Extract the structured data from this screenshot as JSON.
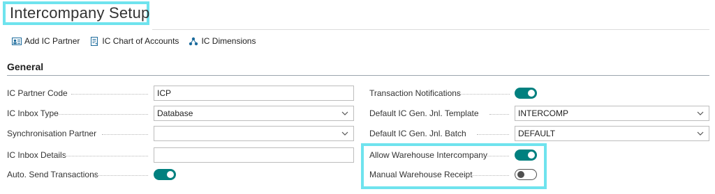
{
  "page": {
    "title": "Intercompany Setup"
  },
  "actions": [
    {
      "label": "Add IC Partner",
      "icon": "add-partner-icon"
    },
    {
      "label": "IC Chart of Accounts",
      "icon": "chart-of-accounts-icon"
    },
    {
      "label": "IC Dimensions",
      "icon": "dimensions-icon"
    }
  ],
  "section": {
    "title": "General"
  },
  "left_fields": [
    {
      "label": "IC Partner Code",
      "type": "text",
      "value": "ICP"
    },
    {
      "label": "IC Inbox Type",
      "type": "select",
      "value": "Database"
    },
    {
      "label": "Synchronisation Partner",
      "type": "select",
      "value": ""
    },
    {
      "label": "IC Inbox Details",
      "type": "text",
      "value": ""
    },
    {
      "label": "Auto. Send Transactions",
      "type": "toggle",
      "value": true
    }
  ],
  "right_fields": [
    {
      "label": "Transaction Notifications",
      "type": "toggle",
      "value": true
    },
    {
      "label": "Default IC Gen. Jnl. Template",
      "type": "select",
      "value": "INTERCOMP"
    },
    {
      "label": "Default IC Gen. Jnl. Batch",
      "type": "select",
      "value": "DEFAULT"
    },
    {
      "label": "Allow Warehouse Intercompany",
      "type": "toggle",
      "value": true
    },
    {
      "label": "Manual Warehouse Receipt",
      "type": "toggle",
      "value": false
    }
  ],
  "colors": {
    "accent": "#00807f",
    "highlight": "#6fe3ee"
  }
}
